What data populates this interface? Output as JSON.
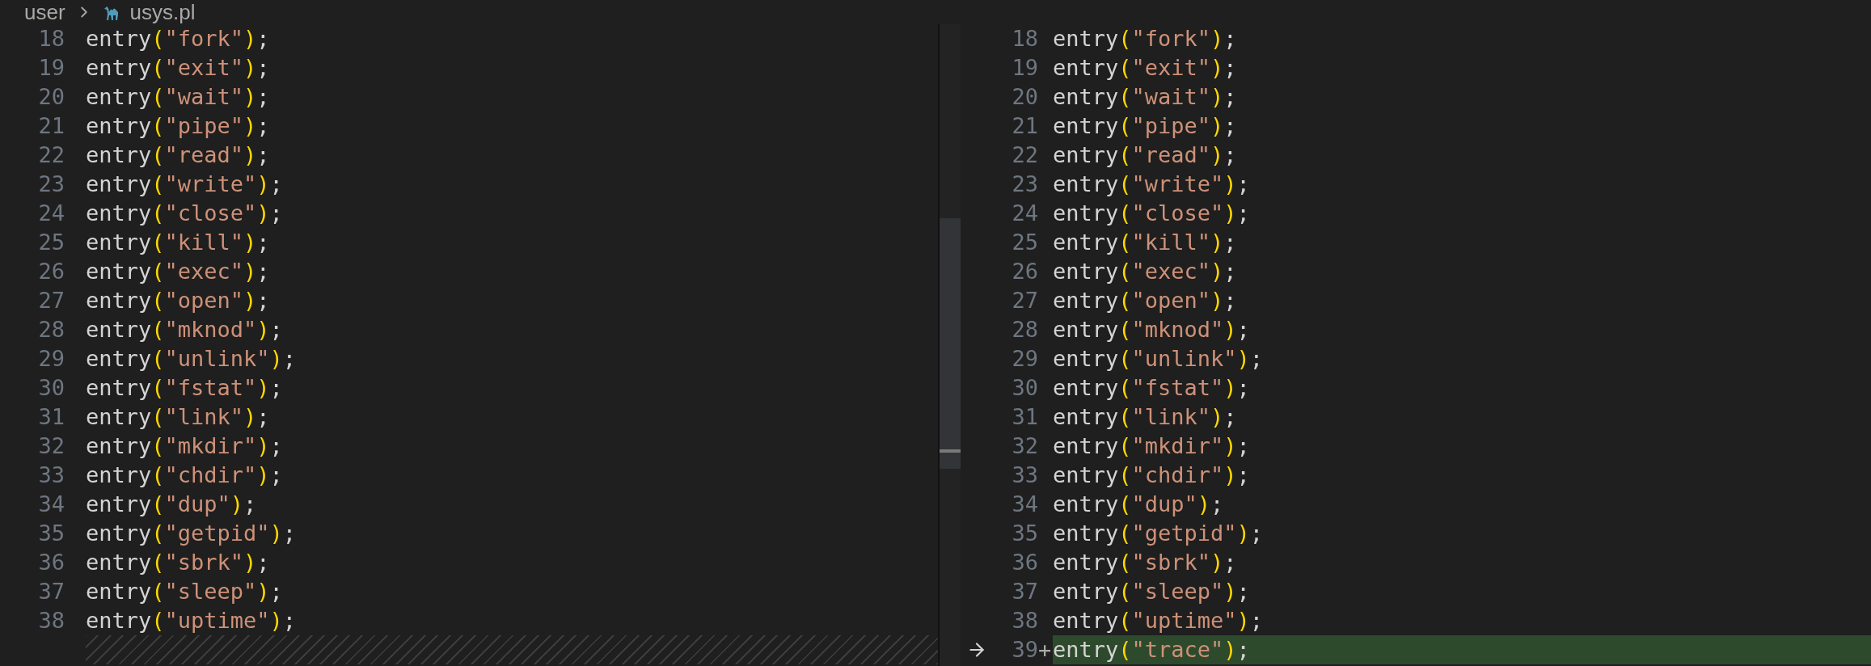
{
  "breadcrumb": {
    "folder": "user",
    "file": "usys.pl"
  },
  "left_pane": {
    "lines": [
      {
        "kind": "code",
        "number": "18",
        "code": [
          "entry",
          "(",
          "\"fork\"",
          ")",
          ";"
        ]
      },
      {
        "kind": "code",
        "number": "19",
        "code": [
          "entry",
          "(",
          "\"exit\"",
          ")",
          ";"
        ]
      },
      {
        "kind": "code",
        "number": "20",
        "code": [
          "entry",
          "(",
          "\"wait\"",
          ")",
          ";"
        ]
      },
      {
        "kind": "code",
        "number": "21",
        "code": [
          "entry",
          "(",
          "\"pipe\"",
          ")",
          ";"
        ]
      },
      {
        "kind": "code",
        "number": "22",
        "code": [
          "entry",
          "(",
          "\"read\"",
          ")",
          ";"
        ]
      },
      {
        "kind": "code",
        "number": "23",
        "code": [
          "entry",
          "(",
          "\"write\"",
          ")",
          ";"
        ]
      },
      {
        "kind": "code",
        "number": "24",
        "code": [
          "entry",
          "(",
          "\"close\"",
          ")",
          ";"
        ]
      },
      {
        "kind": "code",
        "number": "25",
        "code": [
          "entry",
          "(",
          "\"kill\"",
          ")",
          ";"
        ]
      },
      {
        "kind": "code",
        "number": "26",
        "code": [
          "entry",
          "(",
          "\"exec\"",
          ")",
          ";"
        ]
      },
      {
        "kind": "code",
        "number": "27",
        "code": [
          "entry",
          "(",
          "\"open\"",
          ")",
          ";"
        ]
      },
      {
        "kind": "code",
        "number": "28",
        "code": [
          "entry",
          "(",
          "\"mknod\"",
          ")",
          ";"
        ]
      },
      {
        "kind": "code",
        "number": "29",
        "code": [
          "entry",
          "(",
          "\"unlink\"",
          ")",
          ";"
        ]
      },
      {
        "kind": "code",
        "number": "30",
        "code": [
          "entry",
          "(",
          "\"fstat\"",
          ")",
          ";"
        ]
      },
      {
        "kind": "code",
        "number": "31",
        "code": [
          "entry",
          "(",
          "\"link\"",
          ")",
          ";"
        ]
      },
      {
        "kind": "code",
        "number": "32",
        "code": [
          "entry",
          "(",
          "\"mkdir\"",
          ")",
          ";"
        ]
      },
      {
        "kind": "code",
        "number": "33",
        "code": [
          "entry",
          "(",
          "\"chdir\"",
          ")",
          ";"
        ]
      },
      {
        "kind": "code",
        "number": "34",
        "code": [
          "entry",
          "(",
          "\"dup\"",
          ")",
          ";"
        ]
      },
      {
        "kind": "code",
        "number": "35",
        "code": [
          "entry",
          "(",
          "\"getpid\"",
          ")",
          ";"
        ]
      },
      {
        "kind": "code",
        "number": "36",
        "code": [
          "entry",
          "(",
          "\"sbrk\"",
          ")",
          ";"
        ]
      },
      {
        "kind": "code",
        "number": "37",
        "code": [
          "entry",
          "(",
          "\"sleep\"",
          ")",
          ";"
        ]
      },
      {
        "kind": "code",
        "number": "38",
        "code": [
          "entry",
          "(",
          "\"uptime\"",
          ")",
          ";"
        ]
      },
      {
        "kind": "filler"
      }
    ]
  },
  "right_pane": {
    "lines": [
      {
        "kind": "code",
        "number": "18",
        "added": false,
        "code": [
          "entry",
          "(",
          "\"fork\"",
          ")",
          ";"
        ]
      },
      {
        "kind": "code",
        "number": "19",
        "added": false,
        "code": [
          "entry",
          "(",
          "\"exit\"",
          ")",
          ";"
        ]
      },
      {
        "kind": "code",
        "number": "20",
        "added": false,
        "code": [
          "entry",
          "(",
          "\"wait\"",
          ")",
          ";"
        ]
      },
      {
        "kind": "code",
        "number": "21",
        "added": false,
        "code": [
          "entry",
          "(",
          "\"pipe\"",
          ")",
          ";"
        ]
      },
      {
        "kind": "code",
        "number": "22",
        "added": false,
        "code": [
          "entry",
          "(",
          "\"read\"",
          ")",
          ";"
        ]
      },
      {
        "kind": "code",
        "number": "23",
        "added": false,
        "code": [
          "entry",
          "(",
          "\"write\"",
          ")",
          ";"
        ]
      },
      {
        "kind": "code",
        "number": "24",
        "added": false,
        "code": [
          "entry",
          "(",
          "\"close\"",
          ")",
          ";"
        ]
      },
      {
        "kind": "code",
        "number": "25",
        "added": false,
        "code": [
          "entry",
          "(",
          "\"kill\"",
          ")",
          ";"
        ]
      },
      {
        "kind": "code",
        "number": "26",
        "added": false,
        "code": [
          "entry",
          "(",
          "\"exec\"",
          ")",
          ";"
        ]
      },
      {
        "kind": "code",
        "number": "27",
        "added": false,
        "code": [
          "entry",
          "(",
          "\"open\"",
          ")",
          ";"
        ]
      },
      {
        "kind": "code",
        "number": "28",
        "added": false,
        "code": [
          "entry",
          "(",
          "\"mknod\"",
          ")",
          ";"
        ]
      },
      {
        "kind": "code",
        "number": "29",
        "added": false,
        "code": [
          "entry",
          "(",
          "\"unlink\"",
          ")",
          ";"
        ]
      },
      {
        "kind": "code",
        "number": "30",
        "added": false,
        "code": [
          "entry",
          "(",
          "\"fstat\"",
          ")",
          ";"
        ]
      },
      {
        "kind": "code",
        "number": "31",
        "added": false,
        "code": [
          "entry",
          "(",
          "\"link\"",
          ")",
          ";"
        ]
      },
      {
        "kind": "code",
        "number": "32",
        "added": false,
        "code": [
          "entry",
          "(",
          "\"mkdir\"",
          ")",
          ";"
        ]
      },
      {
        "kind": "code",
        "number": "33",
        "added": false,
        "code": [
          "entry",
          "(",
          "\"chdir\"",
          ")",
          ";"
        ]
      },
      {
        "kind": "code",
        "number": "34",
        "added": false,
        "code": [
          "entry",
          "(",
          "\"dup\"",
          ")",
          ";"
        ]
      },
      {
        "kind": "code",
        "number": "35",
        "added": false,
        "code": [
          "entry",
          "(",
          "\"getpid\"",
          ")",
          ";"
        ]
      },
      {
        "kind": "code",
        "number": "36",
        "added": false,
        "code": [
          "entry",
          "(",
          "\"sbrk\"",
          ")",
          ";"
        ]
      },
      {
        "kind": "code",
        "number": "37",
        "added": false,
        "code": [
          "entry",
          "(",
          "\"sleep\"",
          ")",
          ";"
        ]
      },
      {
        "kind": "code",
        "number": "38",
        "added": false,
        "code": [
          "entry",
          "(",
          "\"uptime\"",
          ")",
          ";"
        ]
      },
      {
        "kind": "code",
        "number": "39",
        "added": true,
        "change_mark": "+",
        "code": [
          "entry",
          "(",
          "\"trace\"",
          ")",
          ";"
        ]
      }
    ]
  }
}
